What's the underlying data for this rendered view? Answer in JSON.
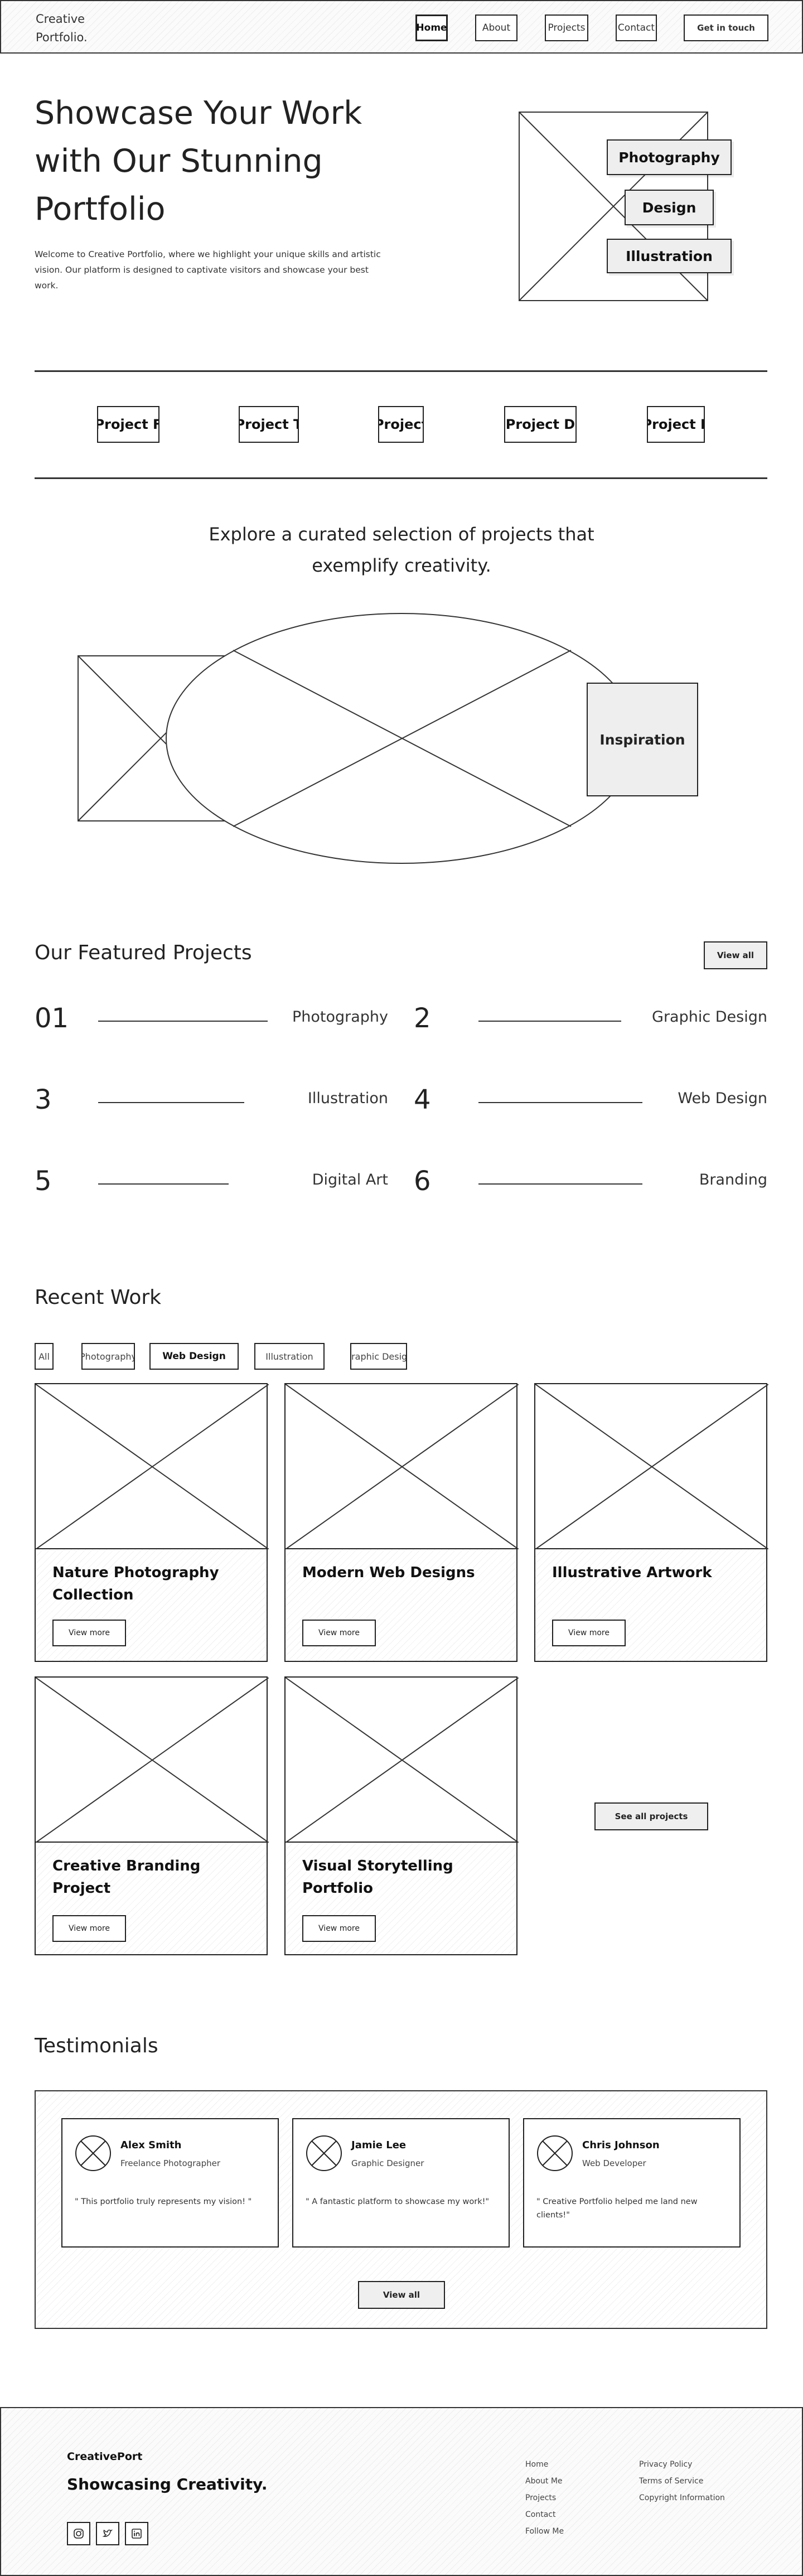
{
  "header": {
    "brand_line1": "Creative",
    "brand_line2": "Portfolio.",
    "nav": [
      "Home",
      "About",
      "Projects",
      "Contact"
    ],
    "cta": "Get in touch"
  },
  "hero": {
    "title_line1": "Showcase Your Work",
    "title_line2": "with Our Stunning",
    "title_line3": "Portfolio",
    "text": "Welcome to Creative Portfolio, where we highlight your unique skills and artistic vision. Our platform is designed to captivate visitors and showcase your best work.",
    "tags": [
      "Photography",
      "Design",
      "Illustration"
    ]
  },
  "project_strip": [
    "Project F",
    "Project T",
    "Project",
    "Project D",
    "Project E"
  ],
  "explore": {
    "line1": "Explore a curated selection of projects that",
    "line2": "exemplify creativity.",
    "tag": "Inspiration"
  },
  "featured": {
    "title": "Our Featured Projects",
    "view_all": "View all",
    "items": [
      {
        "num": "01",
        "name": "Photography"
      },
      {
        "num": "2",
        "name": "Graphic Design"
      },
      {
        "num": "3",
        "name": "Illustration"
      },
      {
        "num": "4",
        "name": "Web Design"
      },
      {
        "num": "5",
        "name": "Digital Art"
      },
      {
        "num": "6",
        "name": "Branding"
      }
    ]
  },
  "recent": {
    "title": "Recent Work",
    "filters": [
      "All",
      "Photography",
      "Web Design",
      "Illustration",
      "Graphic Design"
    ],
    "active_filter": "Web Design",
    "cards": [
      {
        "title": "Nature Photography Collection",
        "button": "View more"
      },
      {
        "title": "Modern Web Designs",
        "button": "View more"
      },
      {
        "title": "Illustrative Artwork",
        "button": "View more"
      },
      {
        "title": "Creative Branding Project",
        "button": "View more"
      },
      {
        "title": "Visual Storytelling Portfolio",
        "button": "View more"
      }
    ],
    "see_all": "See all projects"
  },
  "testimonials": {
    "title": "Testimonials",
    "items": [
      {
        "name": "Alex Smith",
        "role": "Freelance Photographer",
        "quote": "\" This portfolio truly represents my vision! \""
      },
      {
        "name": "Jamie Lee",
        "role": "Graphic Designer",
        "quote": "\" A fantastic platform to showcase my work!\""
      },
      {
        "name": "Chris Johnson",
        "role": "Web Developer",
        "quote": "\" Creative Portfolio helped me land new clients!\""
      }
    ],
    "view_all": "View all"
  },
  "footer": {
    "brand": "CreativePort",
    "tagline": "Showcasing Creativity.",
    "socials": [
      "instagram-icon",
      "twitter-icon",
      "linkedin-icon"
    ],
    "links_col1": [
      "Home",
      "About Me",
      "Projects",
      "Contact",
      "Follow Me"
    ],
    "links_col2": [
      "Privacy Policy",
      "Terms of Service",
      "Copyright Information"
    ]
  }
}
